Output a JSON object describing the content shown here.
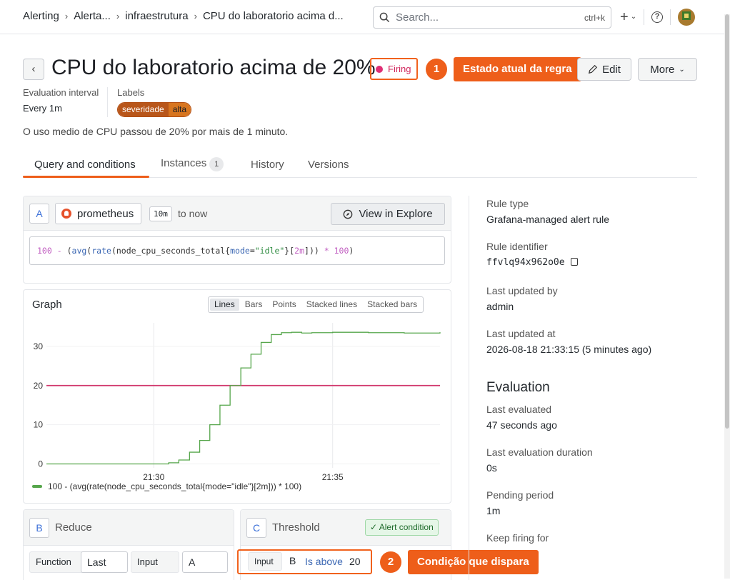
{
  "breadcrumb": [
    "Alerting",
    "Alerta...",
    "infraestrutura",
    "CPU do laboratorio acima d..."
  ],
  "search": {
    "placeholder": "Search...",
    "shortcut": "ctrl+k"
  },
  "topbar": {
    "new_label": "+"
  },
  "rule": {
    "title": "CPU do laboratorio acima de 20%",
    "state": "Firing",
    "description": "O uso medio de CPU passou de 20% por mais de 1 minuto.",
    "eval_interval_label": "Evaluation interval",
    "eval_interval": "Every 1m",
    "labels_label": "Labels",
    "labels": [
      {
        "key": "severidade",
        "value": "alta"
      }
    ]
  },
  "annotations": [
    {
      "number": "1",
      "text": "Estado atual da regra"
    },
    {
      "number": "2",
      "text": "Condição que dispara"
    }
  ],
  "actions": {
    "edit": "Edit",
    "more": "More"
  },
  "tabs": [
    {
      "label": "Query and conditions",
      "active": true
    },
    {
      "label": "Instances",
      "count": "1"
    },
    {
      "label": "History"
    },
    {
      "label": "Versions"
    }
  ],
  "query": {
    "ref_id": "A",
    "datasource": "prometheus",
    "range": "10m",
    "to_now": "to now",
    "explore": "View in Explore",
    "expr": "100 - (avg(rate(node_cpu_seconds_total{mode=\"idle\"}[2m])) * 100)"
  },
  "graph": {
    "title": "Graph",
    "modes": [
      "Lines",
      "Bars",
      "Points",
      "Stacked lines",
      "Stacked bars"
    ],
    "active_mode": "Lines"
  },
  "chart_data": {
    "type": "line",
    "x_ticks": [
      "21:30",
      "21:35"
    ],
    "y_ticks": [
      0,
      10,
      20,
      30
    ],
    "ylim": [
      -1,
      36
    ],
    "threshold": 20,
    "threshold_color": "#d1366b",
    "series": [
      {
        "name": "100 - (avg(rate(node_cpu_seconds_total{mode=\"idle\"}[2m])) * 100)",
        "color": "#56a64b",
        "x": [
          "21:27:00",
          "21:29:56",
          "21:30:25",
          "21:30:42",
          "21:31:00",
          "21:31:17",
          "21:31:34",
          "21:31:51",
          "21:32:08",
          "21:32:26",
          "21:32:43",
          "21:33:00",
          "21:33:17",
          "21:33:34",
          "21:33:51",
          "21:34:08",
          "21:34:25",
          "21:35:00",
          "21:36:00",
          "21:37:00",
          "21:38:00"
        ],
        "y": [
          0,
          0,
          0.3,
          1,
          3,
          6,
          10,
          15,
          20,
          24.5,
          28,
          31,
          33,
          33.5,
          33.6,
          33.4,
          33.5,
          33.6,
          33.5,
          33.4,
          33.6
        ]
      }
    ],
    "legend": "bottom-left"
  },
  "reduce": {
    "ref_id": "B",
    "title": "Reduce",
    "function_label": "Function",
    "function_value": "Last",
    "input_label": "Input",
    "input_value": "A"
  },
  "threshold": {
    "ref_id": "C",
    "title": "Threshold",
    "alert_condition": "Alert condition",
    "input_label": "Input",
    "input_value": "B",
    "operator": "Is above",
    "value": "20"
  },
  "details": {
    "rule_type_label": "Rule type",
    "rule_type": "Grafana-managed alert rule",
    "rule_id_label": "Rule identifier",
    "rule_id": "ffvlq94x962o0e",
    "updated_by_label": "Last updated by",
    "updated_by": "admin",
    "updated_at_label": "Last updated at",
    "updated_at": "2026-08-18 21:33:15 (5 minutes ago)"
  },
  "evaluation": {
    "heading": "Evaluation",
    "last_evaluated_label": "Last evaluated",
    "last_evaluated": "47 seconds ago",
    "duration_label": "Last evaluation duration",
    "duration": "0s",
    "pending_label": "Pending period",
    "pending": "1m",
    "keep_firing_label": "Keep firing for"
  }
}
